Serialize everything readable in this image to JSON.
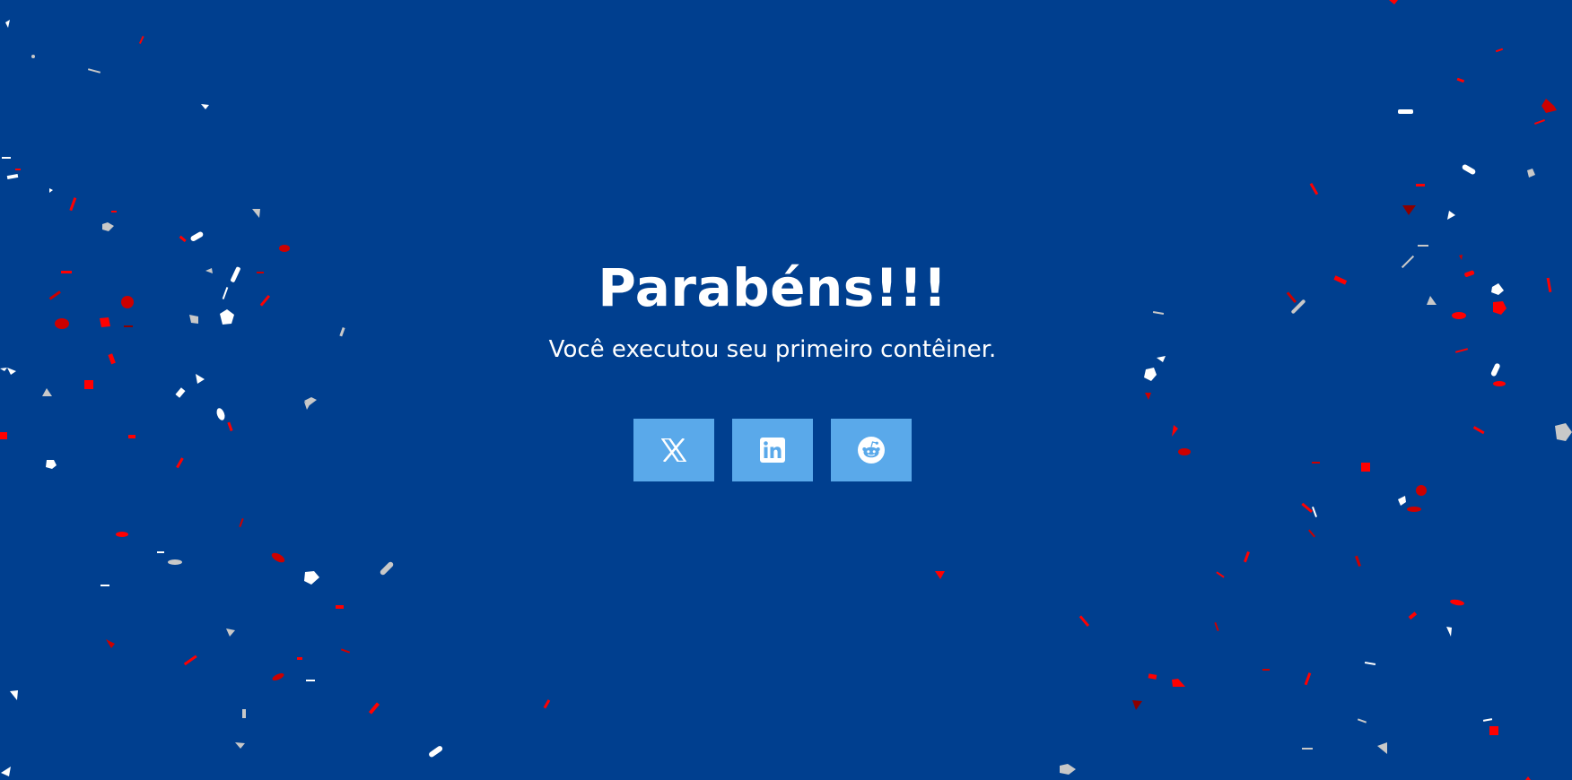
{
  "page": {
    "headline": "Parabéns!!!",
    "subtitle": "Você executou seu primeiro contêiner."
  },
  "share": {
    "buttons": [
      {
        "icon": "x-logo-icon"
      },
      {
        "icon": "linkedin-logo-icon"
      },
      {
        "icon": "reddit-logo-icon"
      }
    ]
  },
  "colors": {
    "background": "#003f8f",
    "button": "#5aa9ea",
    "text": "#ffffff",
    "confetti": [
      "#ff0000",
      "#cc0000",
      "#8b0000",
      "#ffffff",
      "#c8c8c8"
    ]
  }
}
